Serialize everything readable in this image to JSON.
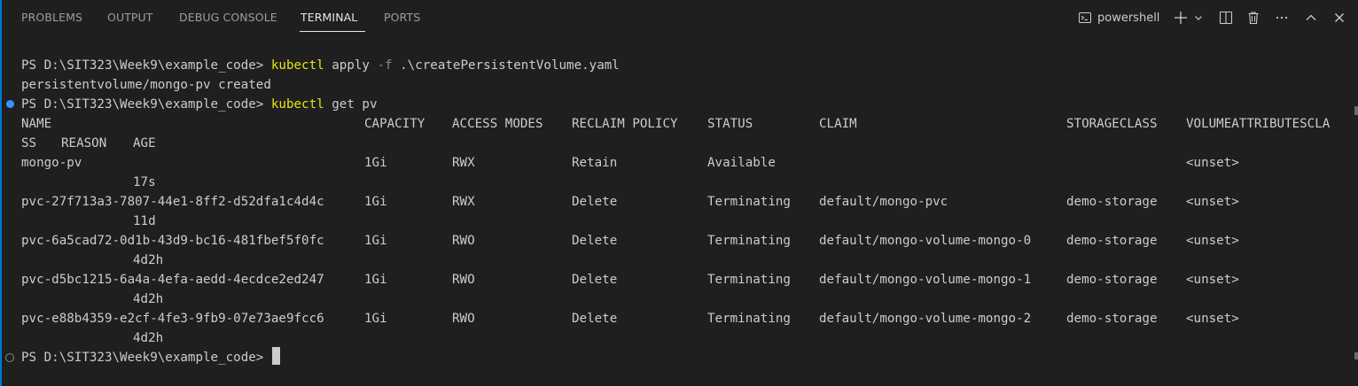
{
  "tabs": [
    {
      "label": "PROBLEMS"
    },
    {
      "label": "OUTPUT"
    },
    {
      "label": "DEBUG CONSOLE"
    },
    {
      "label": "TERMINAL",
      "active": true
    },
    {
      "label": "PORTS"
    }
  ],
  "toolbar": {
    "shell_label": "powershell",
    "icons": [
      "terminal-icon",
      "plus-icon",
      "chevron-down-icon",
      "split-icon",
      "trash-icon",
      "more-icon",
      "chevron-up-icon",
      "close-icon"
    ]
  },
  "terminal": {
    "prompt": "PS D:\\SIT323\\Week9\\example_code>",
    "cmd1": {
      "exe": "kubectl",
      "args_a": "apply",
      "flag": "-f",
      "args_b": ".\\createPersistentVolume.yaml"
    },
    "out1": "persistentvolume/mongo-pv created",
    "cmd2": {
      "exe": "kubectl",
      "args": "get pv"
    },
    "table": {
      "headers": [
        "NAME",
        "CAPACITY",
        "ACCESS MODES",
        "RECLAIM POLICY",
        "STATUS",
        "CLAIM",
        "STORAGECLASS",
        "VOLUMEATTRIBUTESCLA"
      ],
      "header_wrap": [
        "SS",
        "REASON",
        "AGE"
      ],
      "rows": [
        {
          "name": "mongo-pv",
          "capacity": "1Gi",
          "access": "RWX",
          "reclaim": "Retain",
          "status": "Available",
          "claim": "",
          "storageclass": "",
          "vac": "<unset>",
          "age": "17s"
        },
        {
          "name": "pvc-27f713a3-7807-44e1-8ff2-d52dfa1c4d4c",
          "capacity": "1Gi",
          "access": "RWX",
          "reclaim": "Delete",
          "status": "Terminating",
          "claim": "default/mongo-pvc",
          "storageclass": "demo-storage",
          "vac": "<unset>",
          "age": "11d"
        },
        {
          "name": "pvc-6a5cad72-0d1b-43d9-bc16-481fbef5f0fc",
          "capacity": "1Gi",
          "access": "RWO",
          "reclaim": "Delete",
          "status": "Terminating",
          "claim": "default/mongo-volume-mongo-0",
          "storageclass": "demo-storage",
          "vac": "<unset>",
          "age": "4d2h"
        },
        {
          "name": "pvc-d5bc1215-6a4a-4efa-aedd-4ecdce2ed247",
          "capacity": "1Gi",
          "access": "RWO",
          "reclaim": "Delete",
          "status": "Terminating",
          "claim": "default/mongo-volume-mongo-1",
          "storageclass": "demo-storage",
          "vac": "<unset>",
          "age": "4d2h"
        },
        {
          "name": "pvc-e88b4359-e2cf-4fe3-9fb9-07e73ae9fcc6",
          "capacity": "1Gi",
          "access": "RWO",
          "reclaim": "Delete",
          "status": "Terminating",
          "claim": "default/mongo-volume-mongo-2",
          "storageclass": "demo-storage",
          "vac": "<unset>",
          "age": "4d2h"
        }
      ]
    }
  },
  "colors": {
    "background": "#1f1f1f",
    "text": "#cccccc",
    "command": "#e5e510",
    "flag": "#8a8a8a",
    "success_decoration": "#3794ff",
    "accent": "#0078d4"
  }
}
